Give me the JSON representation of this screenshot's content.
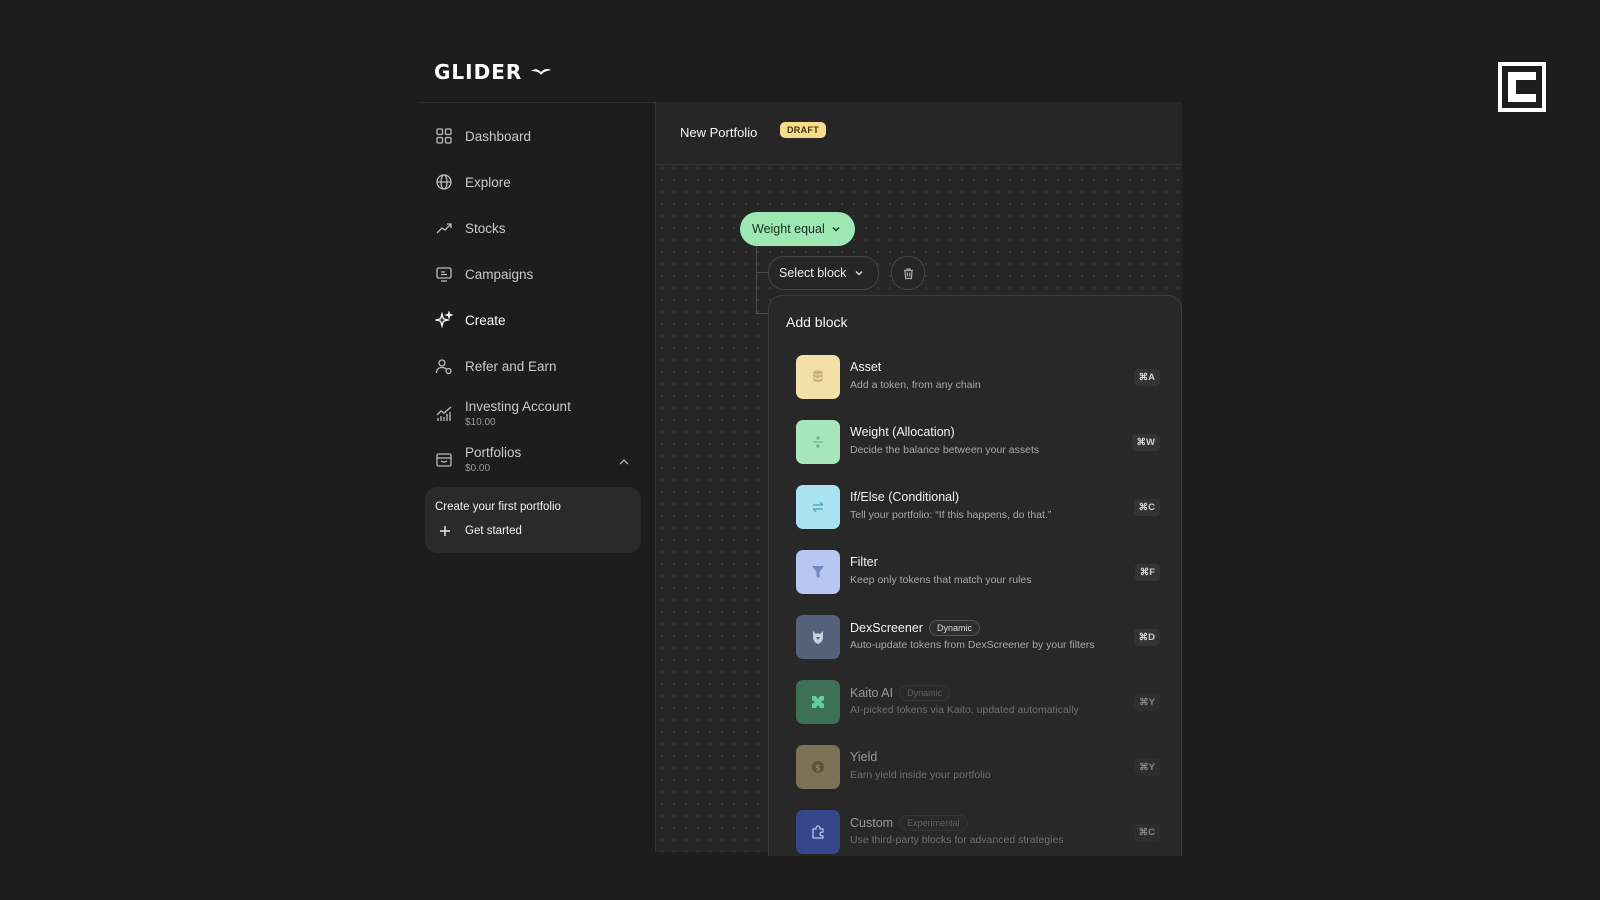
{
  "brand": {
    "name": "GLIDER"
  },
  "sidebar": {
    "items": [
      {
        "label": "Dashboard",
        "icon": "grid-icon"
      },
      {
        "label": "Explore",
        "icon": "globe-icon"
      },
      {
        "label": "Stocks",
        "icon": "trend-up-icon"
      },
      {
        "label": "Campaigns",
        "icon": "ticket-icon"
      },
      {
        "label": "Create",
        "icon": "sparkles-icon"
      },
      {
        "label": "Refer and Earn",
        "icon": "user-plus-icon"
      },
      {
        "label": "Investing Account",
        "sub": "$10.00",
        "icon": "bar-chart-icon"
      },
      {
        "label": "Portfolios",
        "sub": "$0.00",
        "icon": "wallet-icon"
      }
    ],
    "promo": {
      "title": "Create your first portfolio",
      "button": "Get started"
    }
  },
  "header": {
    "title": "New Portfolio",
    "badge": "DRAFT"
  },
  "canvas": {
    "weight_pill": "Weight equal",
    "select_block": "Select block"
  },
  "add_block": {
    "title": "Add block",
    "items": [
      {
        "name": "Asset",
        "desc": "Add a token, from any chain",
        "kbd": "⌘A",
        "color": "#f3e0a6",
        "icon": "coins-icon"
      },
      {
        "name": "Weight (Allocation)",
        "desc": "Decide the balance between your assets",
        "kbd": "⌘W",
        "color": "#a8e7bd",
        "icon": "divide-icon"
      },
      {
        "name": "If/Else (Conditional)",
        "desc": "Tell your portfolio: “If this happens, do that.”",
        "kbd": "⌘C",
        "color": "#a9e3f2",
        "icon": "arrows-swap-icon"
      },
      {
        "name": "Filter",
        "desc": "Keep only tokens that match your rules",
        "kbd": "⌘F",
        "color": "#b8c6f2",
        "icon": "funnel-icon"
      },
      {
        "name": "DexScreener",
        "tag": "Dynamic",
        "desc": "Auto-update tokens from DexScreener by your filters",
        "kbd": "⌘D",
        "color": "#56627a",
        "icon": "dexscreener-icon"
      },
      {
        "name": "Kaito AI",
        "tag": "Dynamic",
        "desc": "AI-picked tokens via Kaito, updated automatically",
        "kbd": "⌘Y",
        "color": "#3e7058",
        "icon": "kaito-icon"
      },
      {
        "name": "Yield",
        "desc": "Earn yield inside your portfolio",
        "kbd": "⌘Y",
        "color": "#7d7156",
        "icon": "dollar-coin-icon"
      },
      {
        "name": "Custom",
        "tag": "Experimental",
        "desc": "Use third-party blocks for advanced strategies",
        "kbd": "⌘C",
        "color": "#35468a",
        "icon": "puzzle-icon"
      }
    ]
  }
}
